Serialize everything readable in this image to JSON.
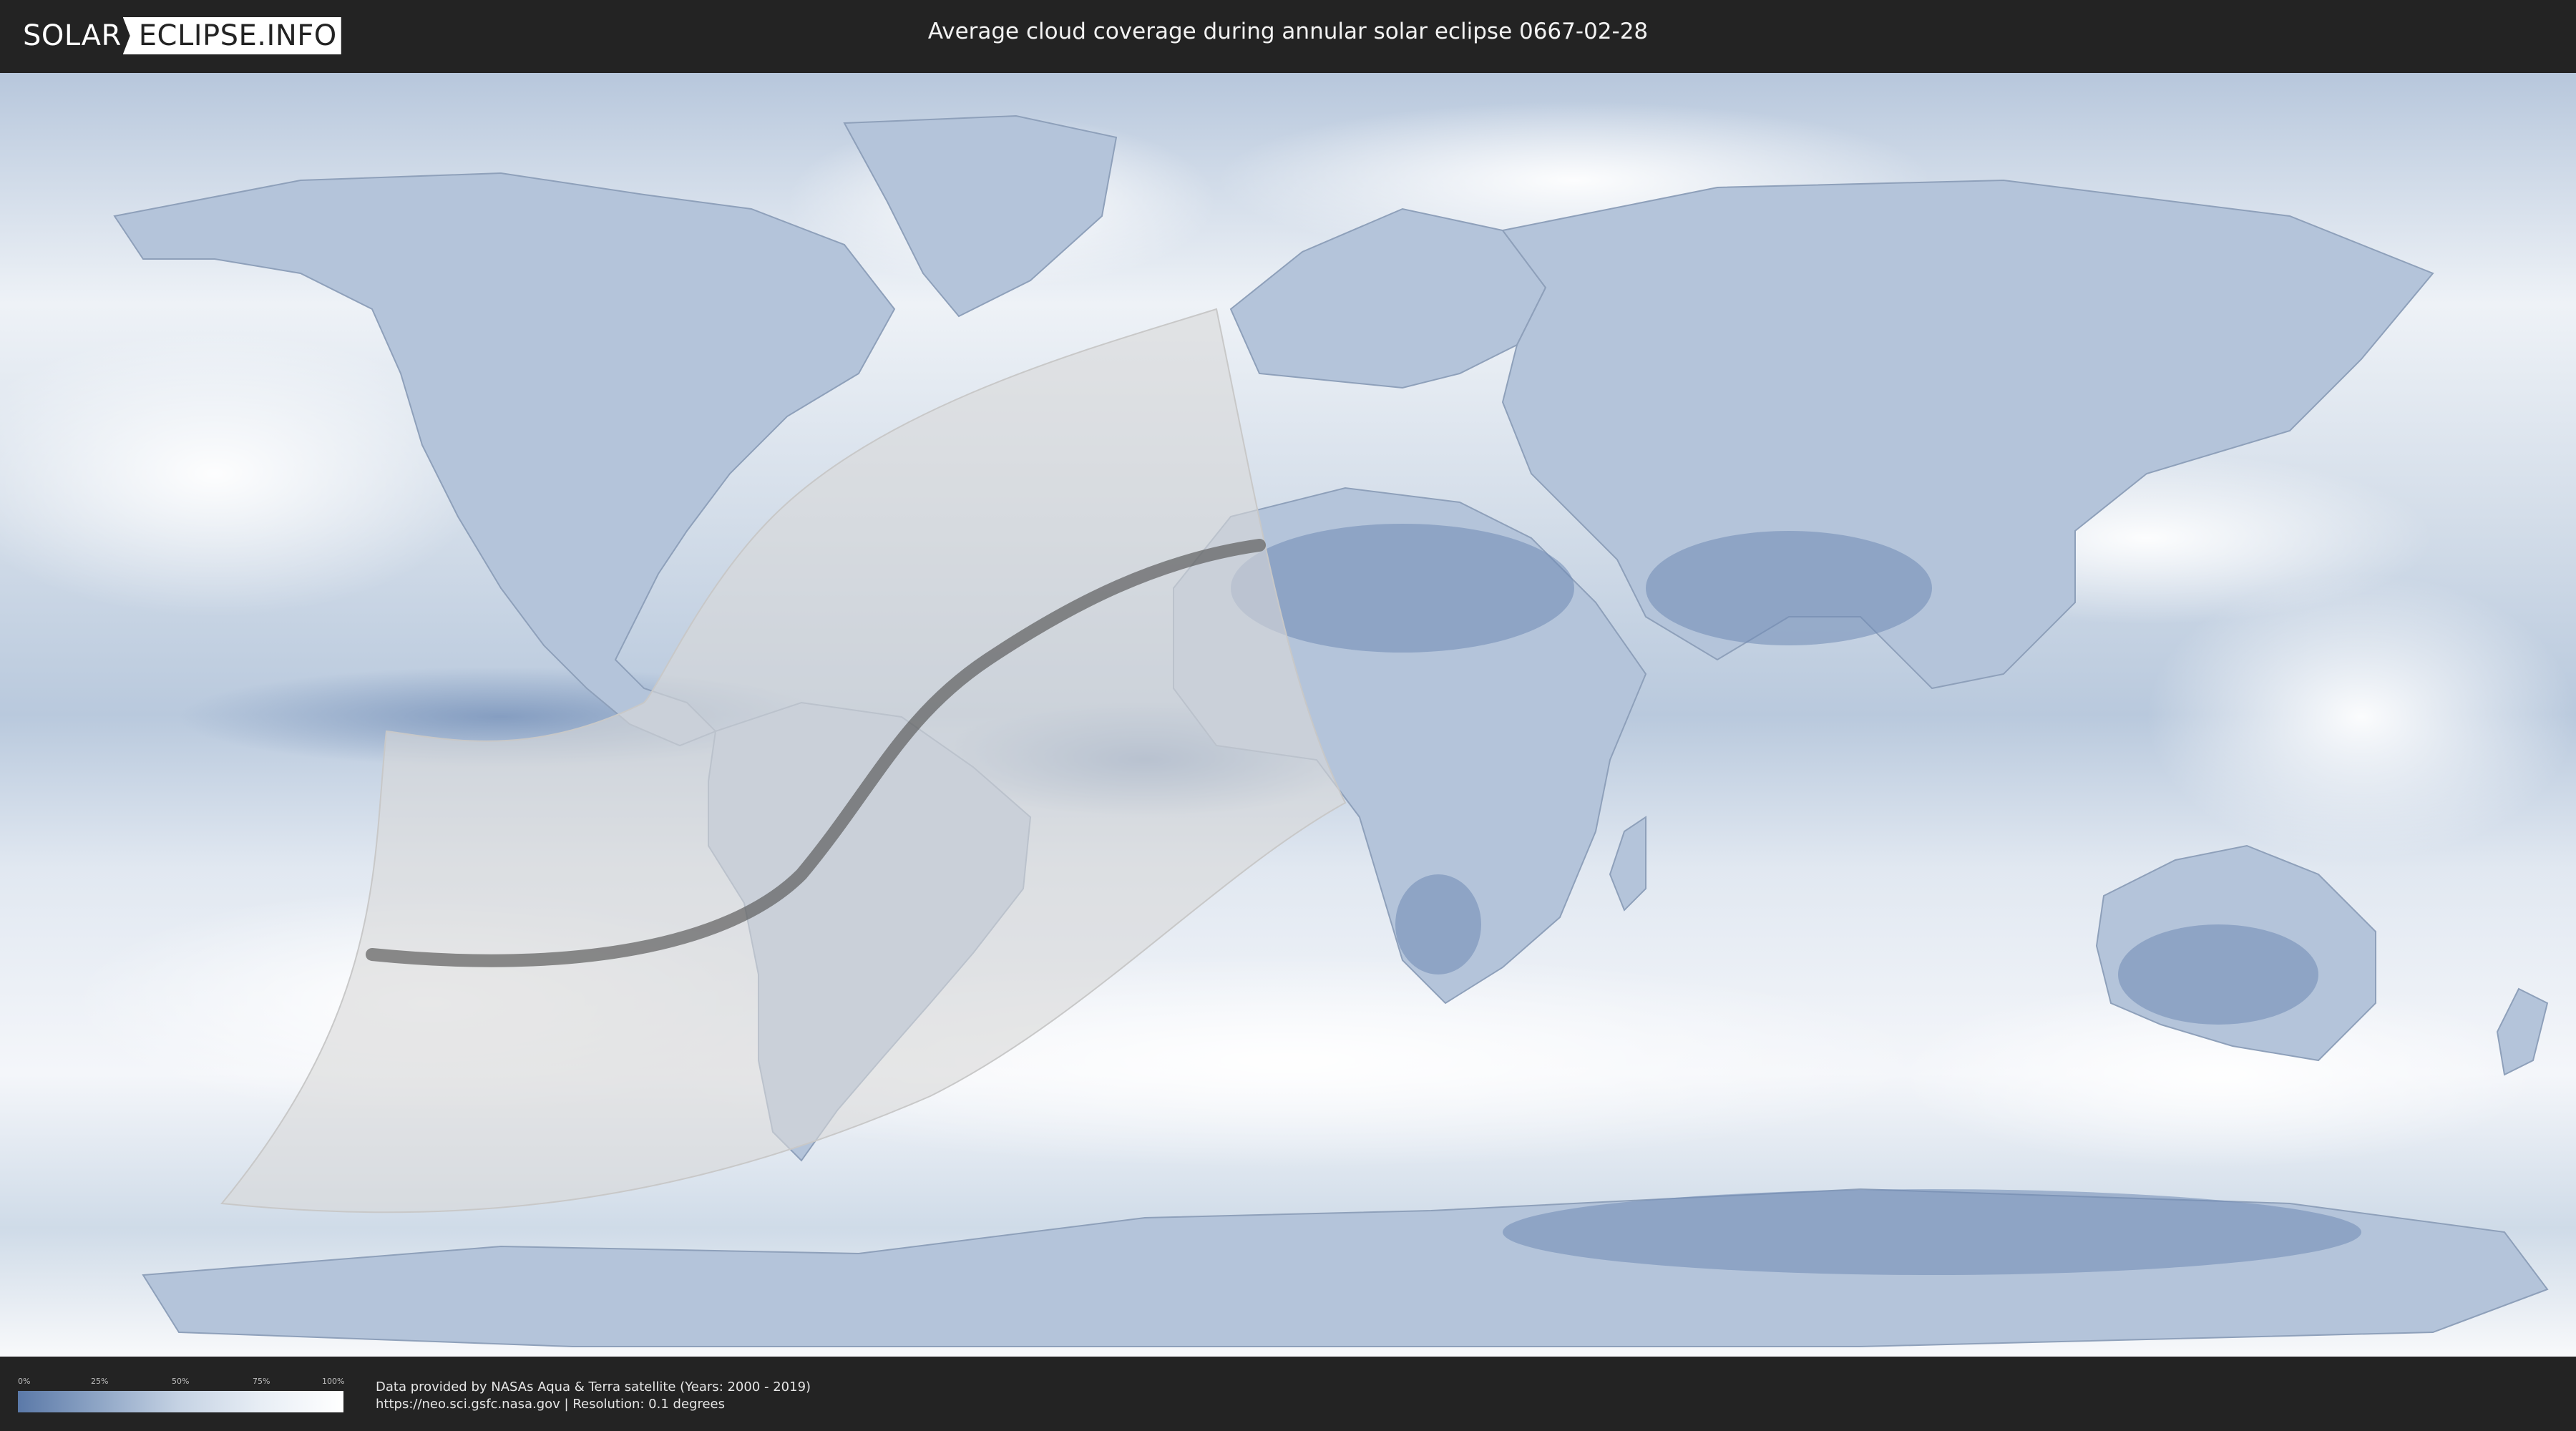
{
  "header": {
    "logo_left": "SOLAR",
    "logo_right": "ECLIPSE.INFO",
    "title": "Average cloud coverage during annular solar eclipse 0667-02-28"
  },
  "map": {
    "projection": "equirectangular",
    "ocean_color": "#dfe6ef",
    "cloud_clear_color": "#5b79a8",
    "cloud_full_color": "#ffffff",
    "eclipse_region_color": "#d6d6d6",
    "central_line_color": "#555555"
  },
  "legend": {
    "ticks": [
      "0%",
      "25%",
      "50%",
      "75%",
      "100%"
    ]
  },
  "footer": {
    "credit_line1": "Data provided by NASAs Aqua & Terra satellite (Years: 2000 - 2019)",
    "credit_line2": "https://neo.sci.gsfc.nasa.gov | Resolution: 0.1 degrees"
  }
}
